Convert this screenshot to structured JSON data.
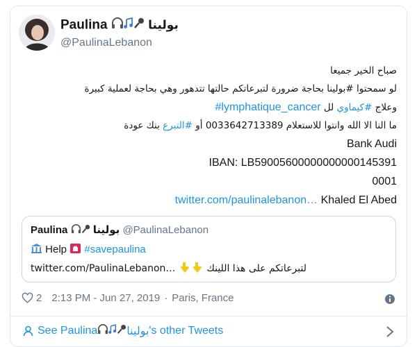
{
  "author": {
    "name": "Paulina",
    "arabic_name": "بولينا",
    "handle": "@PaulinaLebanon"
  },
  "tweet": {
    "line1": "صباح الخير جميعا",
    "line2": "لو سمحتوا #بولينا بحاجة ضرورة لتبرعاتكم حالتها تتدهور وهي بحاجة لعملية كبيرة",
    "line3_prefix": "وعلاج ",
    "line3_hashtag1": "#كيماوي",
    "line3_mid": " لل ",
    "line3_hashtag2": "#lymphatique_cancer",
    "line4_prefix": "ما النا الا الله وانتوا للاستعلام 0033642713389 أو ",
    "line4_hashtag": "#التبرع",
    "line4_suffix": " بنك عودة",
    "bank": "Bank Audi",
    "iban": "IBAN: LB59005600000000000145391",
    "iban_cont": "0001",
    "link": "twitter.com/paulinalebanon…",
    "account_holder": " Khaled El Abed"
  },
  "quote": {
    "name": "Paulina",
    "arabic_name": "بولينا",
    "handle": "@PaulinaLebanon",
    "help": "Help",
    "hashtag": "#savepaulina",
    "link": "twitter.com/PaulinaLebanon…",
    "arabic_text": "لتبرعاتكم على هذا اللينك"
  },
  "meta": {
    "likes": "2",
    "timestamp": "2:13 PM - Jun 27, 2019",
    "separator": "·",
    "location": "Paris, France"
  },
  "footer": {
    "prefix": "See Paulina ",
    "arabic_name": "بولينا",
    "suffix": "'s other Tweets"
  },
  "colors": {
    "link": "#1b95e0",
    "secondary": "#657786",
    "border": "#e1e8ed"
  },
  "icons": [
    "headphones-icon",
    "music-notes-icon",
    "microphone-icon",
    "bank-icon",
    "siren-icon",
    "pointing-down-icon",
    "heart-icon",
    "info-icon",
    "person-icon",
    "chevron-right-icon"
  ]
}
